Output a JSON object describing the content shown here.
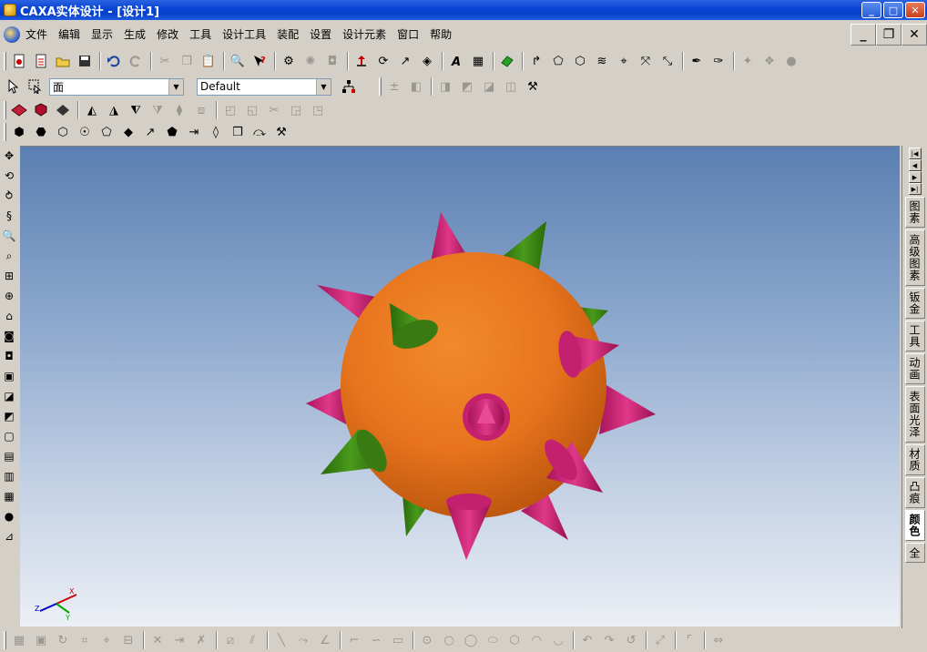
{
  "window": {
    "title": "CAXA实体设计 - [设计1]",
    "minimize": "_",
    "maximize": "□",
    "close": "✕"
  },
  "menu": {
    "items": [
      "文件",
      "编辑",
      "显示",
      "生成",
      "修改",
      "工具",
      "设计工具",
      "装配",
      "设置",
      "设计元素",
      "窗口",
      "帮助"
    ],
    "mdi_minimize": "_",
    "mdi_restore": "❐",
    "mdi_close": "✕"
  },
  "toolbar2": {
    "filter_value": "面",
    "style_value": "Default"
  },
  "side_tabs": [
    "图素",
    "高级图素",
    "钣金",
    "工具",
    "动画",
    "表面光泽",
    "材质",
    "凸痕",
    "颜色",
    "全"
  ],
  "axes": {
    "x": "X",
    "y": "Y",
    "z": "Z"
  },
  "colors": {
    "sphere": "#e8741e",
    "spike_magenta": "#d4267a",
    "spike_green": "#3c8a14",
    "viewport_top": "#5b7fb2",
    "viewport_bottom": "#eceff5"
  }
}
